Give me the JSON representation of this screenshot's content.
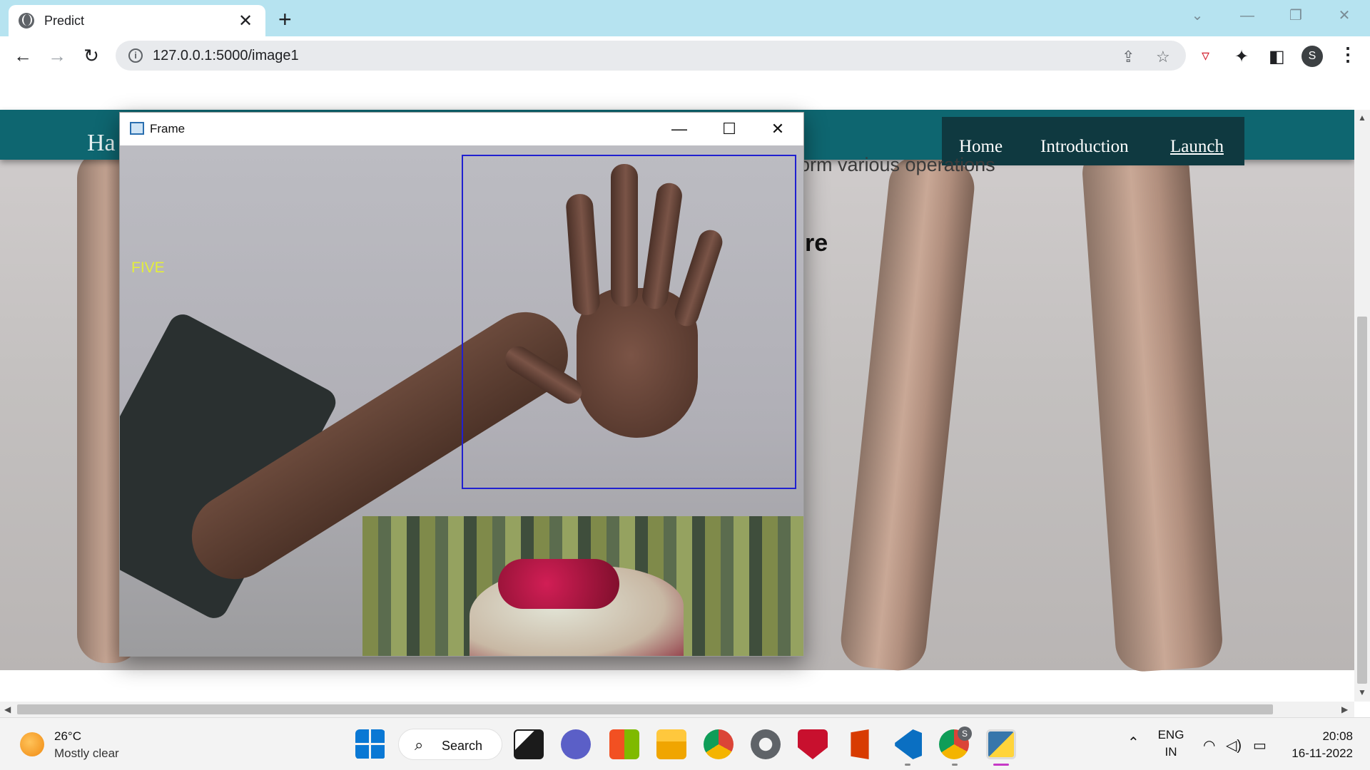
{
  "browser": {
    "tab": {
      "title": "Predict",
      "close_glyph": "✕"
    },
    "new_tab_glyph": "+",
    "url": "127.0.0.1:5000/image1",
    "window_controls": {
      "dropdown": "⌄",
      "minimize": "—",
      "restore": "❐",
      "close": "✕"
    },
    "profile_initial": "S"
  },
  "page": {
    "brand": "Ha",
    "nav": [
      {
        "label": "Home"
      },
      {
        "label": "Introduction"
      },
      {
        "label": "Launch"
      }
    ],
    "text_fragment": "orm various operations",
    "heading_fragment": "re"
  },
  "frame_window": {
    "title": "Frame",
    "prediction_label": "FIVE",
    "controls": {
      "minimize": "—",
      "maximize": "☐",
      "close": "✕"
    },
    "roi_color": "#2020d0"
  },
  "taskbar": {
    "weather": {
      "temp": "26°C",
      "desc": "Mostly clear"
    },
    "search_label": "Search",
    "lang": {
      "line1": "ENG",
      "line2": "IN"
    },
    "clock": {
      "time": "20:08",
      "date": "16-11-2022"
    },
    "chrome_badge": "S"
  },
  "colors": {
    "tabstrip": "#b6e3f0",
    "header": "#0e6670",
    "nav_bar": "#0f3940",
    "label_yellow": "#e4ee3a"
  }
}
